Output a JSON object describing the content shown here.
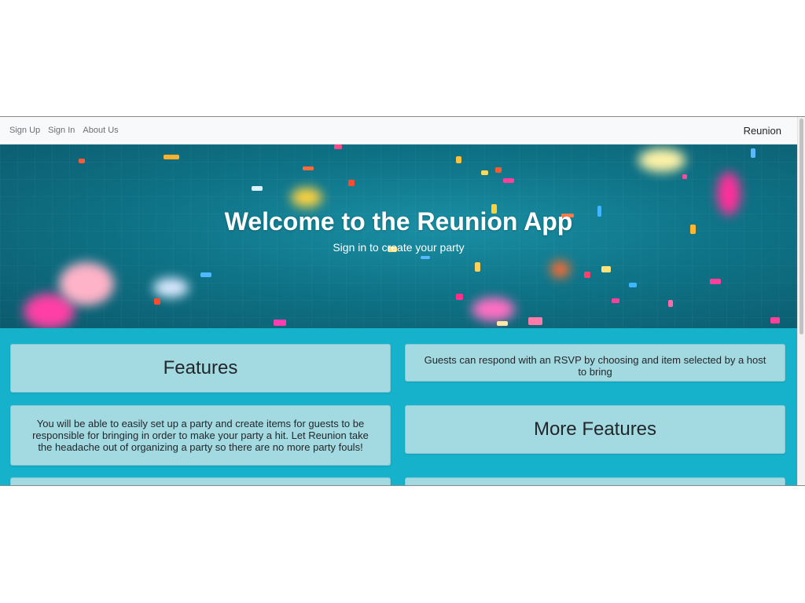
{
  "navbar": {
    "links": [
      "Sign Up",
      "Sign In",
      "About Us"
    ],
    "brand": "Reunion"
  },
  "hero": {
    "title": "Welcome to the Reunion App",
    "subtitle": "Sign in to create your party"
  },
  "features": {
    "features_heading": "Features",
    "rsvp_text": "Guests can respond with an RSVP by choosing and item selected by a host to bring",
    "description_text": "You will be able to easily set up a party and create items for guests to be responsible for bringing in order to make your party a hit. Let Reunion take the headache out of organizing a party so there are no more party fouls!",
    "more_features_heading": "More Features"
  },
  "colors": {
    "navbar_bg": "#f8f9fa",
    "page_bg": "#16b2cc",
    "card_bg": "#a3d9e0",
    "hero_bg": "#0f7488"
  }
}
